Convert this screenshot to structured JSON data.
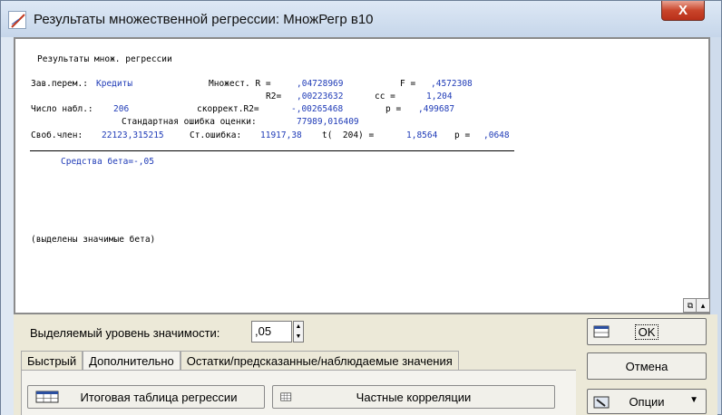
{
  "window": {
    "title": "Результаты множественной регрессии: МножРегр в10",
    "close_label": "X"
  },
  "report": {
    "heading": "Результаты множ. регрессии",
    "dep_var_label": "Зав.перем.:",
    "dep_var_value": "Кредиты",
    "multiple_r_label": "Множест. R = ",
    "multiple_r_value": ",04728969",
    "f_label": "F = ",
    "f_value": ",4572308",
    "r2_label": "R2= ",
    "r2_value": ",00223632",
    "df_label": "cc = ",
    "df_value": "1,204",
    "n_label": "Число набл.: ",
    "n_value": "206",
    "adj_r2_label": "скоррект.R2= ",
    "adj_r2_value": "-,00265468",
    "p_label": "p = ",
    "p_value": ",499687",
    "std_err_label": "Стандартная ошибка оценки:",
    "std_err_value": "77989,016409",
    "intercept_label": "Своб.член: ",
    "intercept_value": "22123,315215",
    "intercept_se_label": "Ст.ошибка: ",
    "intercept_se_value": "11917,38",
    "t_label": "t(  204) = ",
    "t_value": "1,8564",
    "p2_label": "p = ",
    "p2_value": ",0648",
    "beta_line": "Средства бета=-,05",
    "note": "(выделены значимые бета)"
  },
  "controls": {
    "significance_label": "Выделяемый уровень значимости:",
    "significance_value": ",05",
    "tabs": [
      {
        "label": "Быстрый",
        "active": false
      },
      {
        "label": "Дополнительно",
        "active": true
      },
      {
        "label": "Остатки/предсказанные/наблюдаемые значения",
        "active": false
      }
    ],
    "summary_table_button": "Итоговая таблица регрессии",
    "partial_corr_button": "Частные корреляции",
    "ok_button": "OK",
    "cancel_button": "Отмена",
    "options_button": "Опции"
  },
  "colors": {
    "value_blue": "#1f3bb7",
    "frame": "#cfdcec",
    "panel": "#ece9d8"
  }
}
